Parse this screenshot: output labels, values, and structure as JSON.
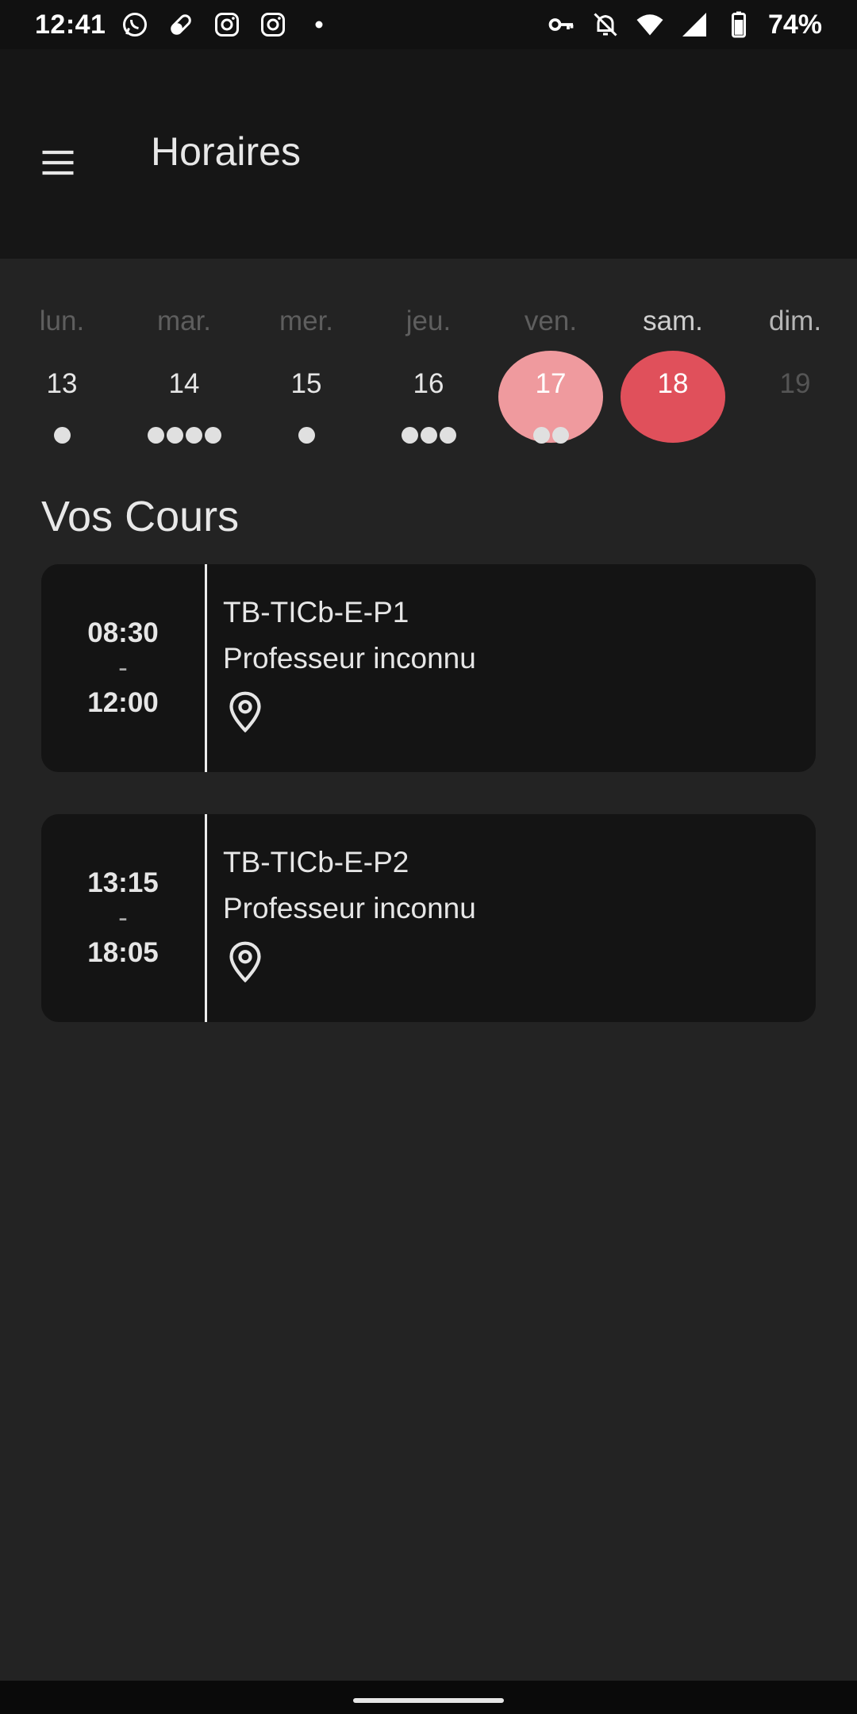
{
  "status_bar": {
    "time": "12:41",
    "battery": "74%",
    "left_icons": [
      "whatsapp-icon",
      "pill-icon",
      "instagram-icon",
      "instagram-icon",
      "dot-icon"
    ],
    "right_icons": [
      "vpn-key-icon",
      "do-not-disturb-bell-icon",
      "wifi-icon",
      "cell-signal-icon",
      "battery-icon"
    ]
  },
  "app_bar": {
    "title": "Horaires",
    "menu_icon": "menu-icon"
  },
  "week": {
    "days": [
      {
        "name": "lun.",
        "num": "13",
        "dots": 1,
        "state": "normal"
      },
      {
        "name": "mar.",
        "num": "14",
        "dots": 4,
        "state": "normal"
      },
      {
        "name": "mer.",
        "num": "15",
        "dots": 1,
        "state": "normal"
      },
      {
        "name": "jeu.",
        "num": "16",
        "dots": 3,
        "state": "normal"
      },
      {
        "name": "ven.",
        "num": "17",
        "dots": 2,
        "state": "prev"
      },
      {
        "name": "sam.",
        "num": "18",
        "dots": 0,
        "state": "selected"
      },
      {
        "name": "dim.",
        "num": "19",
        "dots": 0,
        "state": "next"
      }
    ]
  },
  "section": {
    "title": "Vos Cours"
  },
  "courses": [
    {
      "start": "08:30",
      "sep": "-",
      "end": "12:00",
      "name": "TB-TICb-E-P1",
      "teacher": "Professeur inconnu",
      "location_icon": "location-pin-icon"
    },
    {
      "start": "13:15",
      "sep": "-",
      "end": "18:05",
      "name": "TB-TICb-E-P2",
      "teacher": "Professeur inconnu",
      "location_icon": "location-pin-icon"
    }
  ],
  "colors": {
    "accent": "#e0505b",
    "accent_light": "#ef9a9e",
    "background": "#232323",
    "card": "#141414",
    "app_bar": "#161616"
  }
}
